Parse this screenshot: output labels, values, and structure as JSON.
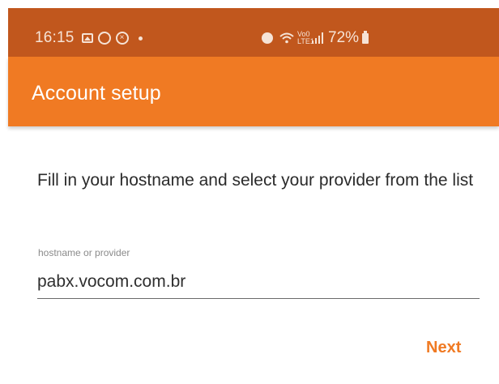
{
  "colors": {
    "status_bar": "#c1571d",
    "app_bar": "#f07a23",
    "accent": "#f07a23",
    "background": "#ffffff"
  },
  "status_bar": {
    "time": "16:15",
    "volte_label": "Vo0 LTE1",
    "battery": "72%",
    "icons": [
      "image-icon",
      "whatsapp-icon",
      "blocked-icon",
      "dot-icon",
      "alarm-icon",
      "wifi-icon",
      "volte-icon",
      "signal-icon",
      "battery-icon"
    ]
  },
  "app_bar": {
    "title": "Account setup"
  },
  "form": {
    "instructions": "Fill in your hostname and select your provider from the list",
    "hostname_label": "hostname or provider",
    "hostname_value": "pabx.vocom.com.br"
  },
  "actions": {
    "next_label": "Next"
  }
}
